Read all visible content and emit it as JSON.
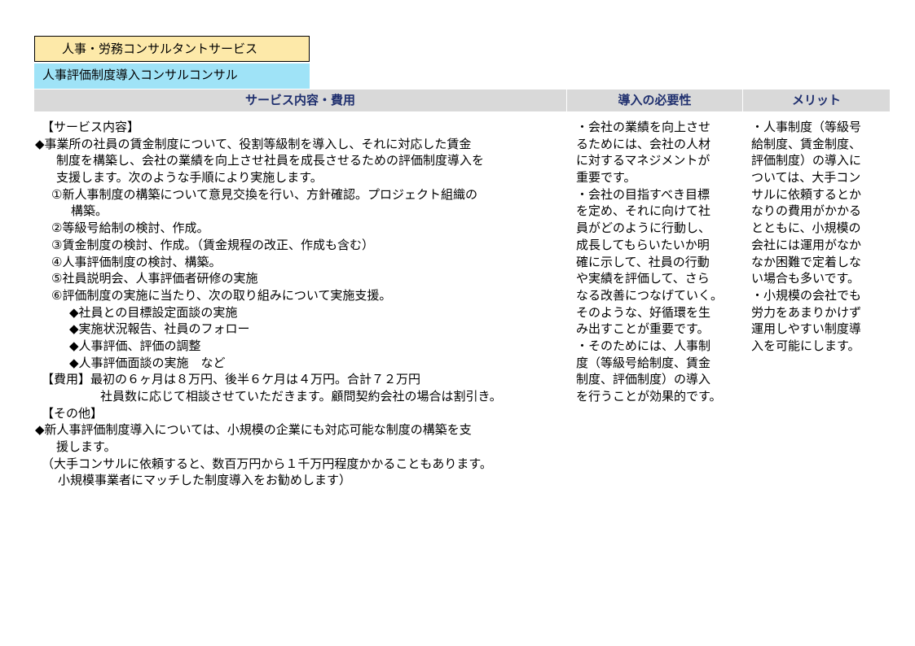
{
  "category_label": "人事・労務コンサルタントサービス",
  "service_label": "人事評価制度導入コンサルコンサル",
  "headers": {
    "service": "サービス内容・費用",
    "necessity": "導入の必要性",
    "merit": "メリット"
  },
  "service_lines": [
    "【サービス内容】",
    "◆事業所の社員の賃金制度について、役割等級制を導入し、それに対応した賃金",
    "制度を構築し、会社の業績を向上させ社員を成長させるための評価制度導入を",
    "支援します。次のような手順により実施します。",
    "①新人事制度の構築について意見交換を行い、方針確認。プロジェクト組織の",
    "構築。",
    "②等級号給制の検討、作成。",
    "③賃金制度の検討、作成。（賃金規程の改正、作成も含む）",
    "④人事評価制度の検討、構築。",
    "⑤社員説明会、人事評価者研修の実施",
    "⑥評価制度の実施に当たり、次の取り組みについて実施支援。",
    "◆社員との目標設定面談の実施",
    "◆実施状況報告、社員のフォロー",
    "◆人事評価、評価の調整",
    "◆人事評価面談の実施　など",
    "【費用】最初の６ヶ月は８万円、後半６ケ月は４万円。合計７２万円",
    "社員数に応じて相談させていただきます。顧問契約会社の場合は割引き。",
    "【その他】",
    "◆新人事評価制度導入については、小規模の企業にも対応可能な制度の構築を支",
    "援します。",
    "（大手コンサルに依頼すると、数百万円から１千万円程度かかることもあります。",
    "小規模事業者にマッチした制度導入をお勧めします）"
  ],
  "necessity_lines": [
    "・会社の業績を向上させ",
    "るためには、会社の人材",
    "に対するマネジメントが",
    "重要です。",
    "・会社の目指すべき目標",
    "を定め、それに向けて社",
    "員がどのように行動し、",
    "成長してもらいたいか明",
    "確に示して、社員の行動",
    "や実績を評価して、さら",
    "なる改善につなげていく。",
    "そのような、好循環を生",
    "み出すことが重要です。",
    "・そのためには、人事制",
    "度（等級号給制度、賃金",
    "制度、評価制度）の導入",
    "を行うことが効果的です。"
  ],
  "merit_lines": [
    "・人事制度（等級号",
    "給制度、賃金制度、",
    "評価制度）の導入に",
    "ついては、大手コン",
    "サルに依頼するとか",
    "なりの費用がかかる",
    "とともに、小規模の",
    "会社には運用がなか",
    "なか困難で定着しな",
    "い場合も多いです。",
    "・小規模の会社でも",
    "労力をあまりかけず",
    "運用しやすい制度導",
    "入を可能にします。"
  ]
}
